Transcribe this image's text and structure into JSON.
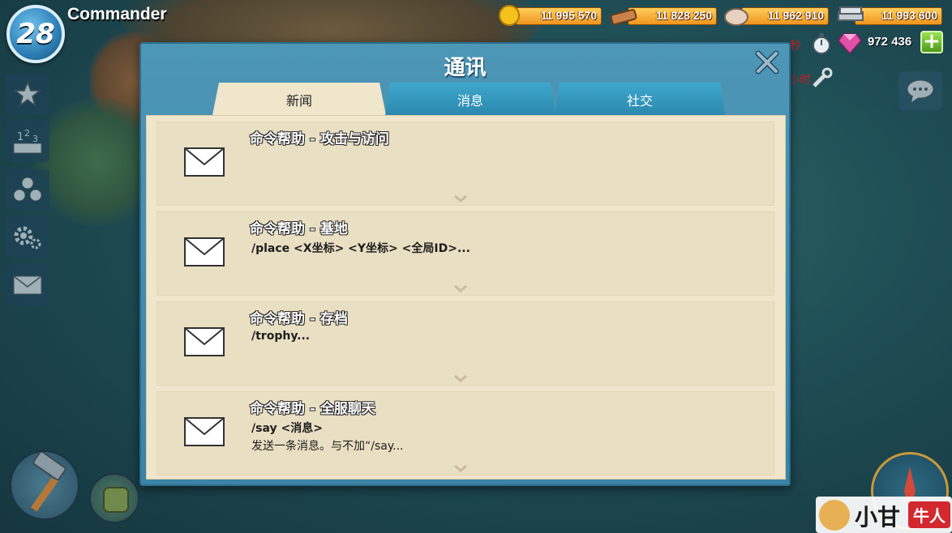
{
  "player": {
    "level": "28",
    "name": "Commander"
  },
  "resources": {
    "gold": "11 995 570",
    "wood": "11 828 250",
    "stone": "11 962 910",
    "iron": "11 993 600",
    "gems": "972 436"
  },
  "status": {
    "timer_fragment": "秒",
    "timer_fragment2": "小时"
  },
  "dialog": {
    "title": "通讯",
    "tabs": [
      {
        "label": "新闻",
        "active": true
      },
      {
        "label": "消息",
        "active": false
      },
      {
        "label": "社交",
        "active": false
      }
    ],
    "messages": [
      {
        "title": "命令帮助 - 攻击与访问",
        "lines": [
          "",
          ""
        ]
      },
      {
        "title": "命令帮助 - 基地",
        "lines": [
          "/place <X坐标> <Y坐标> <全局ID>...",
          ""
        ]
      },
      {
        "title": "命令帮助 - 存档",
        "lines": [
          "/trophy...",
          ""
        ]
      },
      {
        "title": "命令帮助 - 全服聊天",
        "lines": [
          "/say <消息>",
          "发送一条消息。与不加“/say..."
        ]
      }
    ]
  },
  "watermark": {
    "text": "小甘",
    "badge": "牛人"
  }
}
